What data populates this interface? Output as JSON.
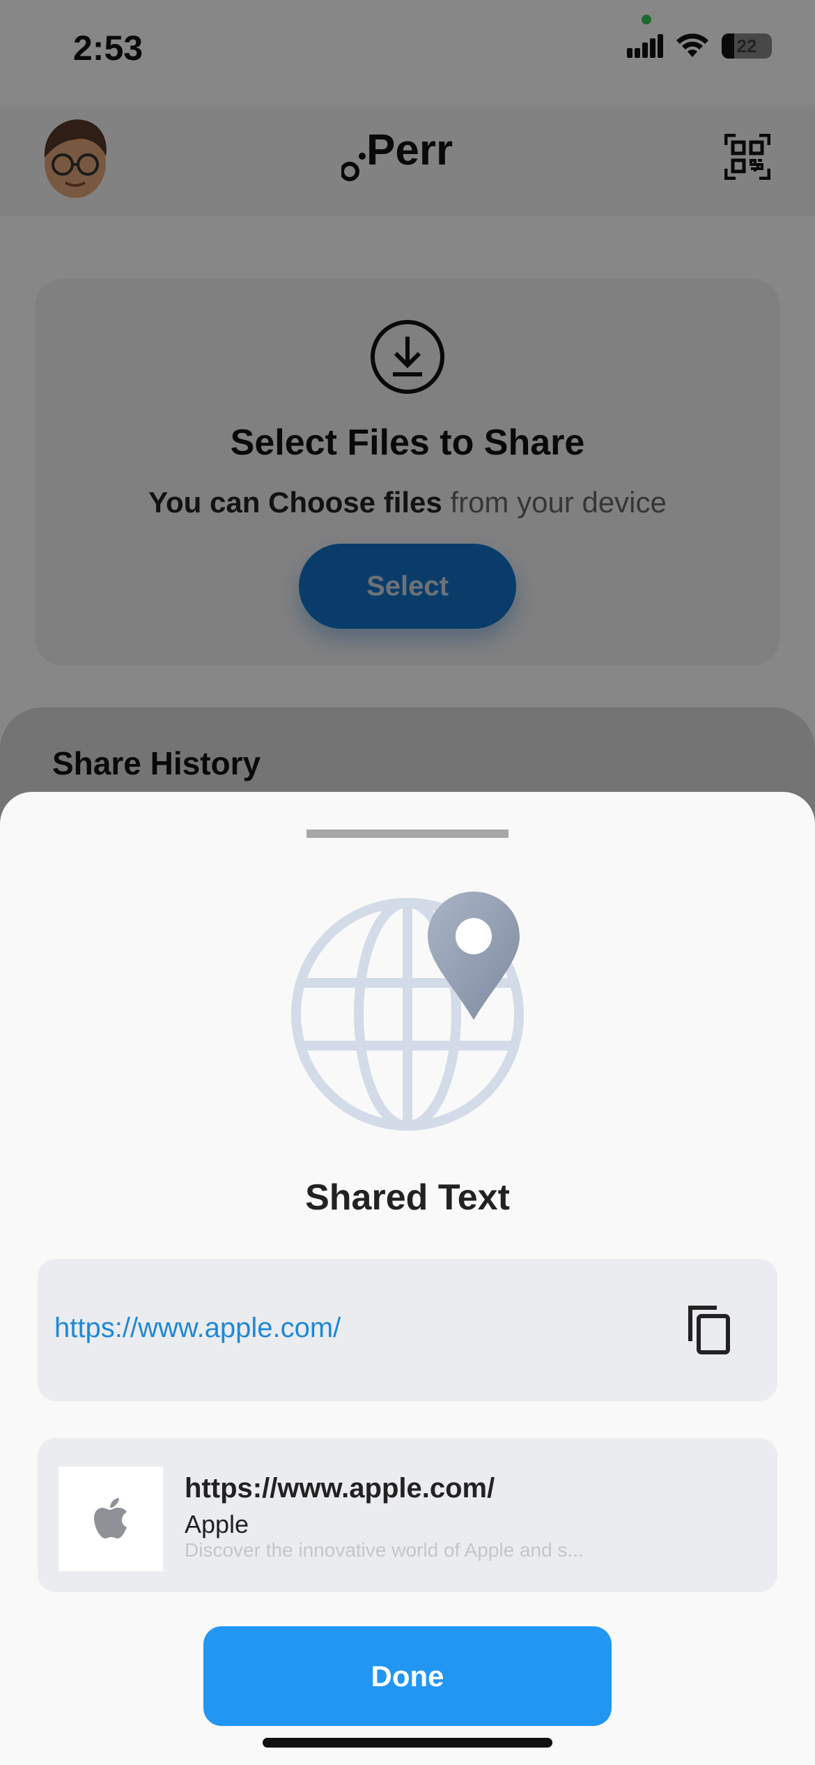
{
  "status_bar": {
    "time": "2:53",
    "battery": "22",
    "icons": [
      "signal-icon",
      "wifi-icon",
      "battery-icon"
    ]
  },
  "header": {
    "logo_text": "Perr",
    "icons": [
      "avatar",
      "qr-code-icon"
    ]
  },
  "select_card": {
    "title": "Select Files to Share",
    "subtitle_strong": "You can Choose files",
    "subtitle_light": "from your device",
    "button_label": "Select",
    "icon": "download-icon"
  },
  "history": {
    "title": "Share History"
  },
  "sheet": {
    "icon": "globe-location-icon",
    "title": "Shared Text",
    "url": "https://www.apple.com/",
    "copy_icon": "copy-icon",
    "preview": {
      "url": "https://www.apple.com/",
      "name": "Apple",
      "description": "Discover the innovative world of Apple and s...",
      "thumb_icon": "apple-logo-icon"
    },
    "done_label": "Done"
  },
  "colors": {
    "accent": "#2196f3",
    "link": "#1e88d7",
    "select_button": "#1472c8",
    "overlay": "rgba(0,0,0,0.47)"
  }
}
